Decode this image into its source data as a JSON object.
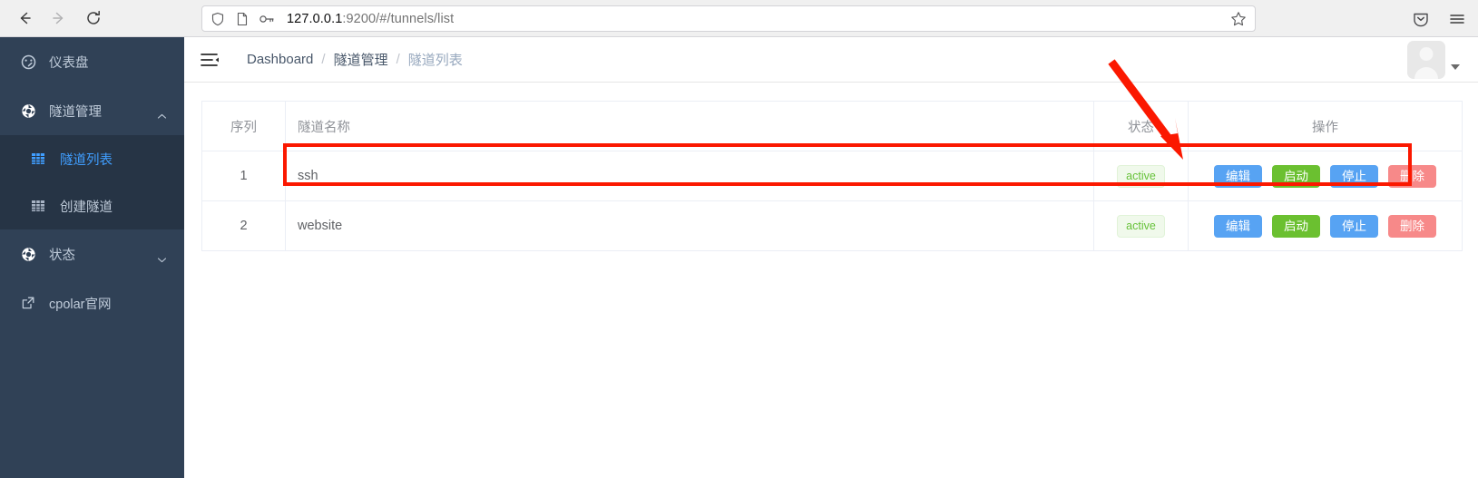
{
  "browser": {
    "back_label": "Back",
    "forward_label": "Forward",
    "reload_label": "Reload",
    "url_host": "127.0.0.1",
    "url_rest": ":9200/#/tunnels/list",
    "url_full": "127.0.0.1:9200/#/tunnels/list",
    "shield_icon": "shield-icon",
    "page_icon": "page-icon",
    "key_icon": "key-icon",
    "star_icon": "bookmark-star-icon",
    "pocket_icon": "pocket-icon",
    "menu_icon": "hamburger-menu-icon"
  },
  "sidebar": {
    "items": [
      {
        "label": "仪表盘",
        "icon": "dashboard-gauge-icon",
        "active": false,
        "chevron": ""
      },
      {
        "label": "隧道管理",
        "icon": "tunnel-circle-icon",
        "active": false,
        "chevron": "up"
      },
      {
        "label": "状态",
        "icon": "status-circle-icon",
        "active": false,
        "chevron": "down"
      },
      {
        "label": "cpolar官网",
        "icon": "external-link-icon",
        "active": false,
        "chevron": ""
      }
    ],
    "submenu": [
      {
        "label": "隧道列表",
        "icon": "table-grid-icon",
        "active": true
      },
      {
        "label": "创建隧道",
        "icon": "table-grid-icon",
        "active": false
      }
    ]
  },
  "header": {
    "collapse_icon": "collapse-sidebar-icon",
    "breadcrumb": [
      {
        "label": "Dashboard",
        "current": false
      },
      {
        "label": "隧道管理",
        "current": false
      },
      {
        "label": "隧道列表",
        "current": true
      }
    ],
    "separator": "/",
    "avatar_icon": "user-avatar-icon",
    "caret_icon": "chevron-down-icon"
  },
  "table": {
    "columns": [
      {
        "key": "seq",
        "label": "序列"
      },
      {
        "key": "name",
        "label": "隧道名称"
      },
      {
        "key": "status",
        "label": "状态"
      },
      {
        "key": "ops",
        "label": "操作"
      }
    ],
    "rows": [
      {
        "seq": "1",
        "name": "ssh",
        "status": "active",
        "buttons": [
          {
            "label": "编辑",
            "kind": "edit"
          },
          {
            "label": "启动",
            "kind": "start"
          },
          {
            "label": "停止",
            "kind": "stop"
          },
          {
            "label": "删除",
            "kind": "delete"
          }
        ]
      },
      {
        "seq": "2",
        "name": "website",
        "status": "active",
        "buttons": [
          {
            "label": "编辑",
            "kind": "edit"
          },
          {
            "label": "启动",
            "kind": "start"
          },
          {
            "label": "停止",
            "kind": "stop"
          },
          {
            "label": "删除",
            "kind": "delete"
          }
        ]
      }
    ]
  },
  "annotations": {
    "highlight_color": "#fb1800",
    "box_target": "row-ssh",
    "arrow_target": "edit-button-row-1"
  },
  "colors": {
    "sidebar_bg": "#304156",
    "submenu_bg": "#263445",
    "active_blue": "#409eff",
    "btn_blue": "#57a3f3",
    "btn_green": "#6bc030",
    "btn_red": "#f78989",
    "tag_green_text": "#67c23a",
    "tag_green_bg": "#f0f9eb"
  }
}
